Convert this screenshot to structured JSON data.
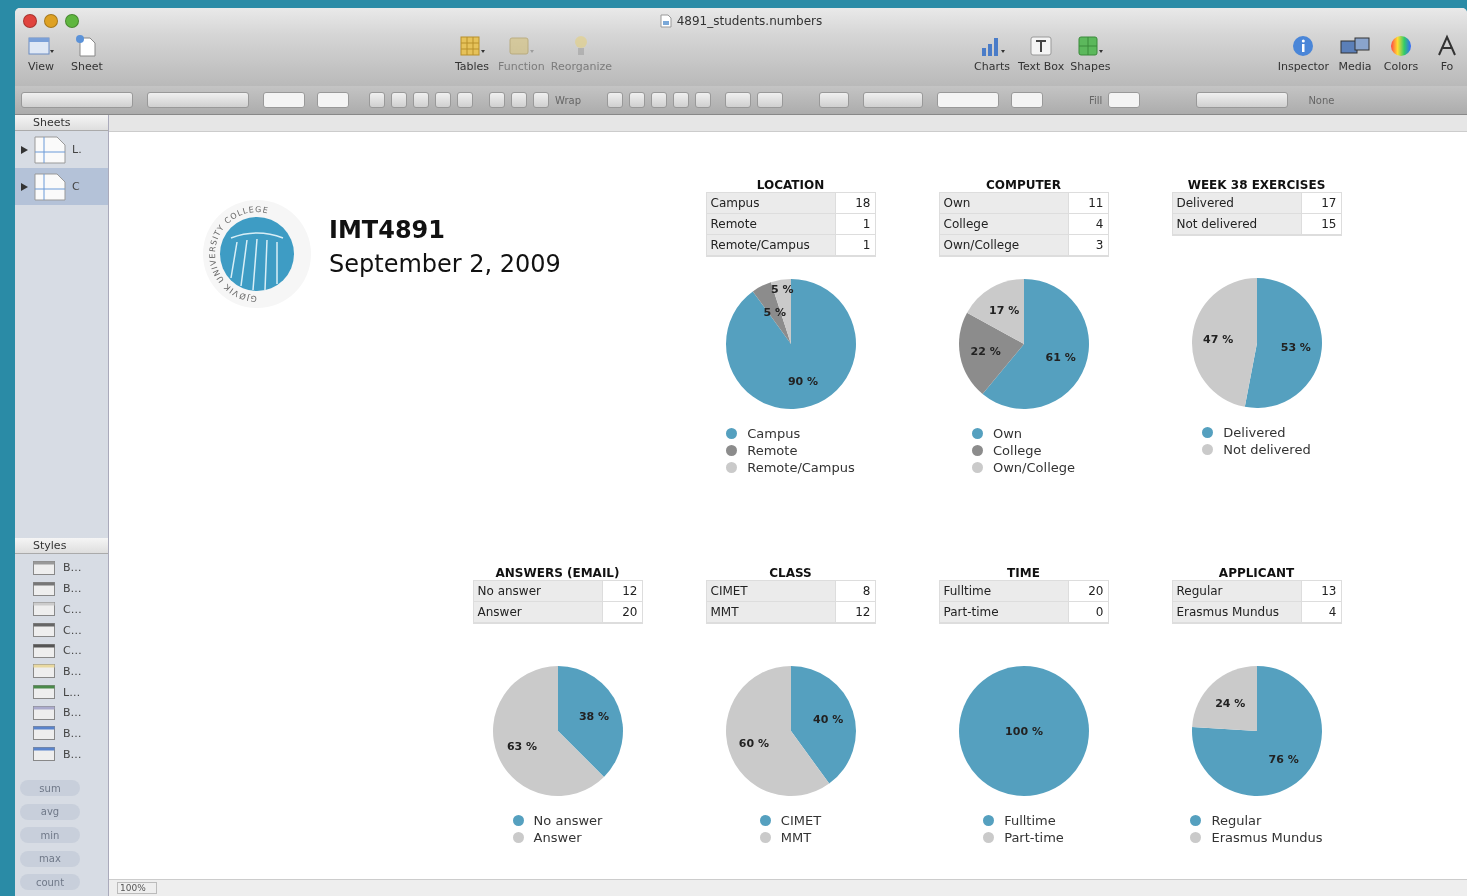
{
  "window": {
    "title": "4891_students.numbers"
  },
  "toolbar": {
    "groups": [
      [
        {
          "label": "View",
          "disabled": false
        },
        {
          "label": "Sheet",
          "disabled": false
        }
      ],
      [
        {
          "label": "Tables",
          "disabled": false
        },
        {
          "label": "Function",
          "disabled": true
        },
        {
          "label": "Reorganize",
          "disabled": true
        }
      ],
      [
        {
          "label": "Charts",
          "disabled": false
        },
        {
          "label": "Text Box",
          "disabled": false
        },
        {
          "label": "Shapes",
          "disabled": false
        }
      ],
      [
        {
          "label": "Inspector",
          "disabled": false
        },
        {
          "label": "Media",
          "disabled": false
        },
        {
          "label": "Colors",
          "disabled": false
        },
        {
          "label": "Fo",
          "disabled": false
        }
      ]
    ]
  },
  "format_bar": {
    "wrap_label": "Wrap",
    "fill_label": "Fill",
    "none_label": "None"
  },
  "sidebar": {
    "sheets_header": "Sheets",
    "sheets": [
      {
        "label": "L.",
        "selected": false
      },
      {
        "label": "C",
        "selected": true
      }
    ],
    "styles_header": "Styles",
    "styles": [
      "B…",
      "B…",
      "C…",
      "C…",
      "C…",
      "B…",
      "L…",
      "B…",
      "B…",
      "B…"
    ],
    "functions": [
      "sum",
      "avg",
      "min",
      "max",
      "count"
    ]
  },
  "document": {
    "logo_text": "GJØVIK UNIVERSITY COLLEGE",
    "course": "IMT4891",
    "date": "September 2, 2009"
  },
  "charts": [
    {
      "title": "LOCATION",
      "rows": [
        {
          "label": "Campus",
          "value": "18"
        },
        {
          "label": "Remote",
          "value": "1"
        },
        {
          "label": "Remote/Campus",
          "value": "1"
        }
      ],
      "chart_data": {
        "type": "pie",
        "values": [
          90,
          5,
          5
        ],
        "value_labels": [
          "90 %",
          "5 %",
          "5 %"
        ]
      },
      "legend": [
        {
          "label": "Campus",
          "color": "#55a0bf"
        },
        {
          "label": "Remote",
          "color": "#8c8c8c"
        },
        {
          "label": "Remote/Campus",
          "color": "#cacaca"
        }
      ]
    },
    {
      "title": "COMPUTER",
      "rows": [
        {
          "label": "Own",
          "value": "11"
        },
        {
          "label": "College",
          "value": "4"
        },
        {
          "label": "Own/College",
          "value": "3"
        }
      ],
      "chart_data": {
        "type": "pie",
        "values": [
          61,
          22,
          17
        ],
        "value_labels": [
          "61 %",
          "22 %",
          "17 %"
        ]
      },
      "legend": [
        {
          "label": "Own",
          "color": "#55a0bf"
        },
        {
          "label": "College",
          "color": "#8c8c8c"
        },
        {
          "label": "Own/College",
          "color": "#cacaca"
        }
      ]
    },
    {
      "title": "WEEK 38 EXERCISES",
      "rows": [
        {
          "label": "Delivered",
          "value": "17"
        },
        {
          "label": "Not delivered",
          "value": "15"
        }
      ],
      "chart_data": {
        "type": "pie",
        "values": [
          53,
          47
        ],
        "value_labels": [
          "53 %",
          "47 %"
        ]
      },
      "legend": [
        {
          "label": "Delivered",
          "color": "#55a0bf"
        },
        {
          "label": "Not delivered",
          "color": "#cacaca"
        }
      ]
    },
    {
      "title": "ANSWERS (EMAIL)",
      "rows": [
        {
          "label": "No answer",
          "value": "12"
        },
        {
          "label": "Answer",
          "value": "20"
        }
      ],
      "chart_data": {
        "type": "pie",
        "values": [
          37.5,
          62.5
        ],
        "value_labels": [
          "38 %",
          "63 %"
        ]
      },
      "legend": [
        {
          "label": "No answer",
          "color": "#55a0bf"
        },
        {
          "label": "Answer",
          "color": "#cacaca"
        }
      ]
    },
    {
      "title": "CLASS",
      "rows": [
        {
          "label": "CIMET",
          "value": "8"
        },
        {
          "label": "MMT",
          "value": "12"
        }
      ],
      "chart_data": {
        "type": "pie",
        "values": [
          40,
          60
        ],
        "value_labels": [
          "40 %",
          "60 %"
        ]
      },
      "legend": [
        {
          "label": "CIMET",
          "color": "#55a0bf"
        },
        {
          "label": "MMT",
          "color": "#cacaca"
        }
      ]
    },
    {
      "title": "TIME",
      "rows": [
        {
          "label": "Fulltime",
          "value": "20"
        },
        {
          "label": "Part-time",
          "value": "0"
        }
      ],
      "chart_data": {
        "type": "pie",
        "values": [
          100,
          0
        ],
        "value_labels": [
          "100 %",
          null
        ]
      },
      "legend": [
        {
          "label": "Fulltime",
          "color": "#55a0bf"
        },
        {
          "label": "Part-time",
          "color": "#cacaca"
        }
      ]
    },
    {
      "title": "APPLICANT",
      "rows": [
        {
          "label": "Regular",
          "value": "13"
        },
        {
          "label": "Erasmus Mundus",
          "value": "4"
        }
      ],
      "chart_data": {
        "type": "pie",
        "values": [
          76,
          24
        ],
        "value_labels": [
          "76 %",
          "24 %"
        ]
      },
      "legend": [
        {
          "label": "Regular",
          "color": "#55a0bf"
        },
        {
          "label": "Erasmus Mundus",
          "color": "#cacaca"
        }
      ]
    }
  ],
  "status_bar": {
    "zoom": "100%"
  }
}
